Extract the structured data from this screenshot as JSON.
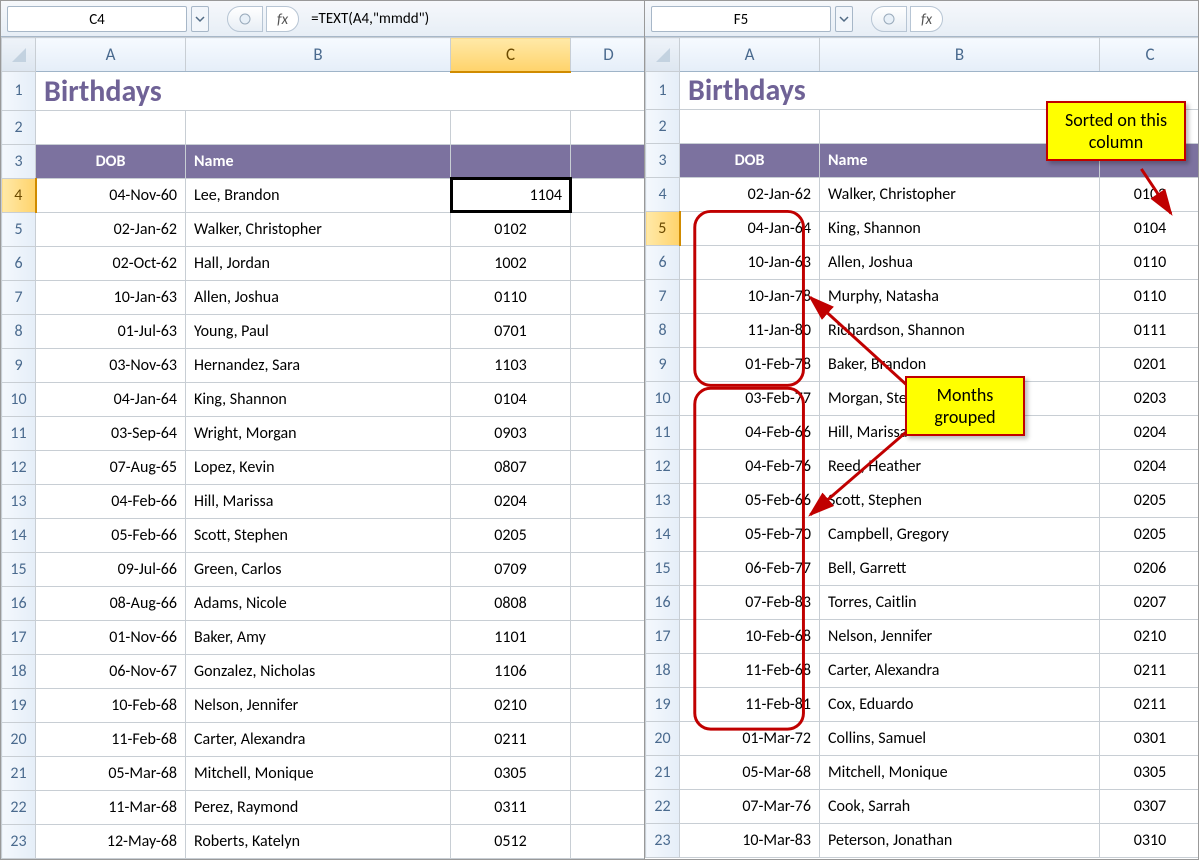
{
  "left": {
    "cell_ref": "C4",
    "fx_symbol": "fx",
    "formula": "=TEXT(A4,\"mmdd\")",
    "title": "Birthdays",
    "headers": {
      "dob": "DOB",
      "name": "Name"
    },
    "selected_row": 4,
    "selected_col": "C",
    "columns": [
      "A",
      "B",
      "C",
      "D"
    ],
    "rows": [
      {
        "n": 4,
        "dob": "04-Nov-60",
        "name": "Lee, Brandon",
        "key": "1104"
      },
      {
        "n": 5,
        "dob": "02-Jan-62",
        "name": "Walker, Christopher",
        "key": "0102"
      },
      {
        "n": 6,
        "dob": "02-Oct-62",
        "name": "Hall, Jordan",
        "key": "1002"
      },
      {
        "n": 7,
        "dob": "10-Jan-63",
        "name": "Allen, Joshua",
        "key": "0110"
      },
      {
        "n": 8,
        "dob": "01-Jul-63",
        "name": "Young, Paul",
        "key": "0701"
      },
      {
        "n": 9,
        "dob": "03-Nov-63",
        "name": "Hernandez, Sara",
        "key": "1103"
      },
      {
        "n": 10,
        "dob": "04-Jan-64",
        "name": "King, Shannon",
        "key": "0104"
      },
      {
        "n": 11,
        "dob": "03-Sep-64",
        "name": "Wright, Morgan",
        "key": "0903"
      },
      {
        "n": 12,
        "dob": "07-Aug-65",
        "name": "Lopez, Kevin",
        "key": "0807"
      },
      {
        "n": 13,
        "dob": "04-Feb-66",
        "name": "Hill, Marissa",
        "key": "0204"
      },
      {
        "n": 14,
        "dob": "05-Feb-66",
        "name": "Scott, Stephen",
        "key": "0205"
      },
      {
        "n": 15,
        "dob": "09-Jul-66",
        "name": "Green, Carlos",
        "key": "0709"
      },
      {
        "n": 16,
        "dob": "08-Aug-66",
        "name": "Adams, Nicole",
        "key": "0808"
      },
      {
        "n": 17,
        "dob": "01-Nov-66",
        "name": "Baker, Amy",
        "key": "1101"
      },
      {
        "n": 18,
        "dob": "06-Nov-67",
        "name": "Gonzalez, Nicholas",
        "key": "1106"
      },
      {
        "n": 19,
        "dob": "10-Feb-68",
        "name": "Nelson, Jennifer",
        "key": "0210"
      },
      {
        "n": 20,
        "dob": "11-Feb-68",
        "name": "Carter, Alexandra",
        "key": "0211"
      },
      {
        "n": 21,
        "dob": "05-Mar-68",
        "name": "Mitchell, Monique",
        "key": "0305"
      },
      {
        "n": 22,
        "dob": "11-Mar-68",
        "name": "Perez, Raymond",
        "key": "0311"
      },
      {
        "n": 23,
        "dob": "12-May-68",
        "name": "Roberts, Katelyn",
        "key": "0512"
      }
    ]
  },
  "right": {
    "cell_ref": "F5",
    "fx_symbol": "fx",
    "formula": "",
    "title": "Birthdays",
    "headers": {
      "dob": "DOB",
      "name": "Name"
    },
    "selected_row": 5,
    "columns": [
      "A",
      "B",
      "C"
    ],
    "callouts": {
      "sorted": "Sorted on this column",
      "months": "Months grouped"
    },
    "rows": [
      {
        "n": 4,
        "dob": "02-Jan-62",
        "name": "Walker, Christopher",
        "key": "0102"
      },
      {
        "n": 5,
        "dob": "04-Jan-64",
        "name": "King, Shannon",
        "key": "0104"
      },
      {
        "n": 6,
        "dob": "10-Jan-63",
        "name": "Allen, Joshua",
        "key": "0110"
      },
      {
        "n": 7,
        "dob": "10-Jan-78",
        "name": "Murphy, Natasha",
        "key": "0110"
      },
      {
        "n": 8,
        "dob": "11-Jan-80",
        "name": "Richardson, Shannon",
        "key": "0111"
      },
      {
        "n": 9,
        "dob": "01-Feb-78",
        "name": "Baker, Brandon",
        "key": "0201"
      },
      {
        "n": 10,
        "dob": "03-Feb-77",
        "name": "Morgan, Steven",
        "key": "0203"
      },
      {
        "n": 11,
        "dob": "04-Feb-66",
        "name": "Hill, Marissa",
        "key": "0204"
      },
      {
        "n": 12,
        "dob": "04-Feb-76",
        "name": "Reed, Heather",
        "key": "0204"
      },
      {
        "n": 13,
        "dob": "05-Feb-66",
        "name": "Scott, Stephen",
        "key": "0205"
      },
      {
        "n": 14,
        "dob": "05-Feb-70",
        "name": "Campbell, Gregory",
        "key": "0205"
      },
      {
        "n": 15,
        "dob": "06-Feb-77",
        "name": "Bell, Garrett",
        "key": "0206"
      },
      {
        "n": 16,
        "dob": "07-Feb-83",
        "name": "Torres, Caitlin",
        "key": "0207"
      },
      {
        "n": 17,
        "dob": "10-Feb-68",
        "name": "Nelson, Jennifer",
        "key": "0210"
      },
      {
        "n": 18,
        "dob": "11-Feb-68",
        "name": "Carter, Alexandra",
        "key": "0211"
      },
      {
        "n": 19,
        "dob": "11-Feb-81",
        "name": "Cox, Eduardo",
        "key": "0211"
      },
      {
        "n": 20,
        "dob": "01-Mar-72",
        "name": "Collins, Samuel",
        "key": "0301"
      },
      {
        "n": 21,
        "dob": "05-Mar-68",
        "name": "Mitchell, Monique",
        "key": "0305"
      },
      {
        "n": 22,
        "dob": "07-Mar-76",
        "name": "Cook, Sarrah",
        "key": "0307"
      },
      {
        "n": 23,
        "dob": "10-Mar-83",
        "name": "Peterson, Jonathan",
        "key": "0310"
      }
    ]
  },
  "col_widths_left": {
    "A": 150,
    "B": 265,
    "C": 120,
    "D": 76
  },
  "col_widths_right": {
    "A": 140,
    "B": 280,
    "C": 101
  }
}
